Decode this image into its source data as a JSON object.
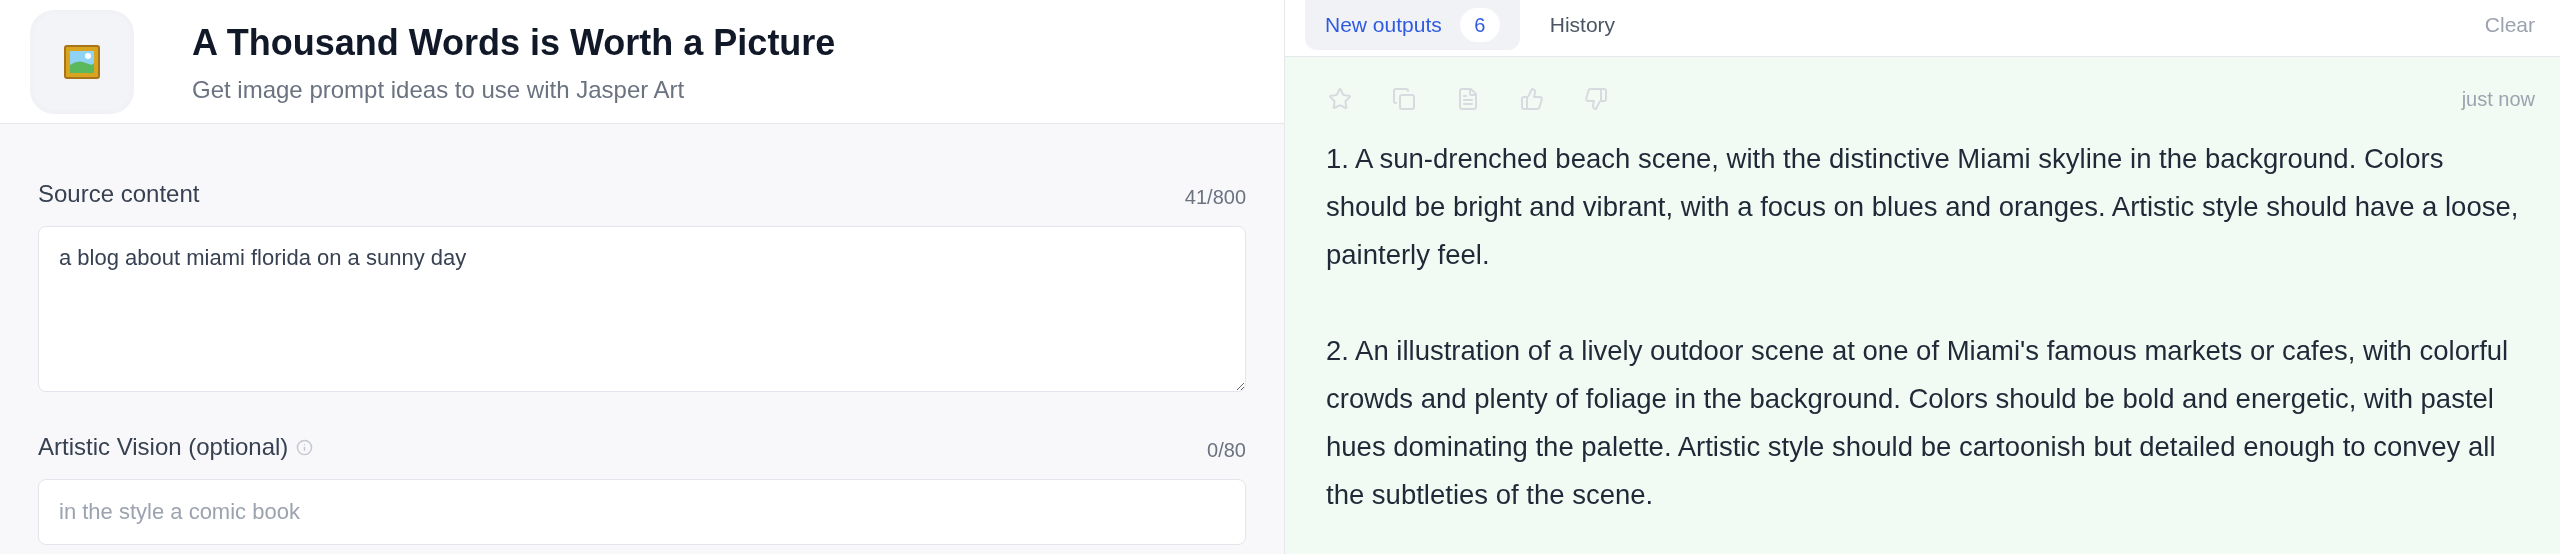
{
  "header": {
    "title": "A Thousand Words is Worth a Picture",
    "subtitle": "Get image prompt ideas to use with Jasper Art"
  },
  "fields": [
    {
      "kind": "textarea",
      "label": "Source content",
      "info": false,
      "counter": "41/800",
      "value": "a blog about miami florida on a sunny day"
    },
    {
      "kind": "input",
      "label": "Artistic Vision (optional)",
      "info": true,
      "counter": "0/80",
      "placeholder": "in the style a comic book"
    }
  ],
  "tabs": [
    {
      "label": "New outputs",
      "badge": "6",
      "selected": true
    },
    {
      "label": "History",
      "selected": false
    }
  ],
  "clear_button": "Clear",
  "output": {
    "time": "just now",
    "paragraphs": [
      "1. A sun-drenched beach scene, with the distinctive Miami skyline in the background. Colors should be bright and vibrant, with a focus on blues and oranges. Artistic style should have a loose, painterly feel.",
      "2. An illustration of a lively outdoor scene at one of Miami's famous markets or cafes, with colorful crowds and plenty of foliage in the background. Colors should be bold and energetic, with pastel hues dominating the palette. Artistic style should be cartoonish but detailed enough to convey all the subtleties of the scene."
    ]
  }
}
